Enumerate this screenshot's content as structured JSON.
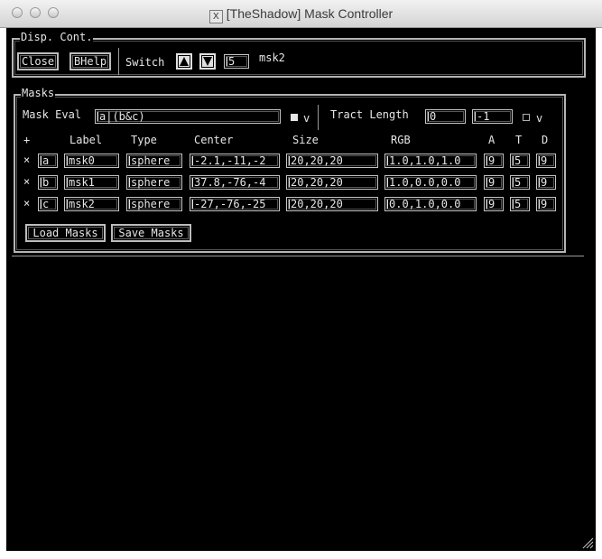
{
  "window": {
    "title": "[TheShadow] Mask Controller"
  },
  "disp": {
    "group_label": "Disp. Cont.",
    "close_label": "Close",
    "bhelp_label": "BHelp",
    "switch_label": "Switch",
    "switch_value": "5",
    "current_mask": "msk2"
  },
  "masks": {
    "group_label": "Masks",
    "eval_label": "Mask Eval",
    "eval_value": "a|(b&c)",
    "eval_v_label": "v",
    "tract_label": "Tract Length",
    "tract_min": "0",
    "tract_max": "-1",
    "tract_v_label": "v",
    "headers": {
      "add": "+",
      "label": "Label",
      "type": "Type",
      "center": "Center",
      "size": "Size",
      "rgb": "RGB",
      "a": "A",
      "t": "T",
      "d": "D"
    },
    "rows": [
      {
        "x": "×",
        "id": "a",
        "label": "msk0",
        "type": "sphere",
        "center": "-2.1,-11,-2",
        "size": "20,20,20",
        "rgb": "1.0,1.0,1.0",
        "a": "9",
        "t": "5",
        "d": "9"
      },
      {
        "x": "×",
        "id": "b",
        "label": "msk1",
        "type": "sphere",
        "center": "37.8,-76,-4",
        "size": "20,20,20",
        "rgb": "1.0,0.0,0.0",
        "a": "9",
        "t": "5",
        "d": "9"
      },
      {
        "x": "×",
        "id": "c",
        "label": "msk2",
        "type": "sphere",
        "center": "-27,-76,-25",
        "size": "20,20,20",
        "rgb": "0.0,1.0,0.0",
        "a": "9",
        "t": "5",
        "d": "9"
      }
    ],
    "load_label": "Load Masks",
    "save_label": "Save Masks"
  }
}
